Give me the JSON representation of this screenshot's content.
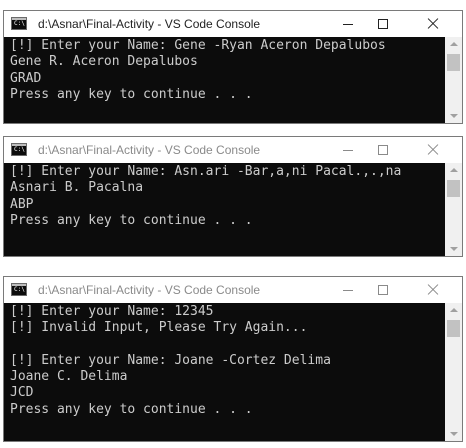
{
  "windows": [
    {
      "title": "d:\\Asnar\\Final-Activity - VS Code Console",
      "lines": [
        "[!] Enter your Name: Gene -Ryan Aceron Depalubos",
        "Gene R. Aceron Depalubos",
        "GRAD",
        "Press any key to continue . . ."
      ]
    },
    {
      "title": "d:\\Asnar\\Final-Activity - VS Code Console",
      "lines": [
        "[!] Enter your Name: Asn.ari -Bar,a,ni Pacal.,.,na",
        "Asnari B. Pacalna",
        "ABP",
        "Press any key to continue . . ."
      ]
    },
    {
      "title": "d:\\Asnar\\Final-Activity - VS Code Console",
      "lines": [
        "[!] Enter your Name: 12345",
        "[!] Invalid Input, Please Try Again...",
        "",
        "[!] Enter your Name: Joane -Cortez Delima",
        "Joane C. Delima",
        "JCD",
        "Press any key to continue . . ."
      ]
    }
  ],
  "icons": {
    "app": "console-app-icon",
    "app_glyph": "C:\\",
    "minimize": "minimize-icon",
    "maximize": "maximize-icon",
    "close": "close-icon"
  },
  "colors": {
    "console_bg": "#0c0c0c",
    "console_text": "#cccccc",
    "titlebar_bg": "#ffffff",
    "scrollbar_bg": "#f0f0f0"
  }
}
